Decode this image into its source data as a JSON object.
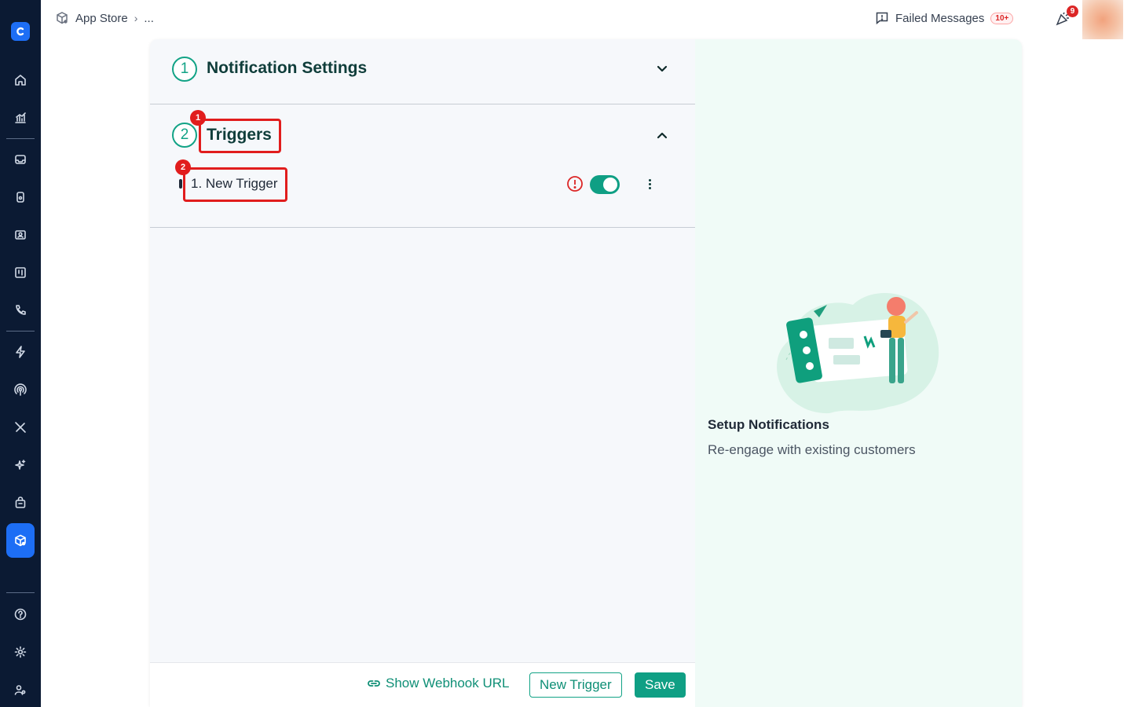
{
  "breadcrumb": {
    "root": "App Store",
    "more": "..."
  },
  "header": {
    "failed_messages_label": "Failed Messages",
    "failed_messages_count": "10+",
    "notification_count": "9"
  },
  "sections": [
    {
      "number": "1",
      "title": "Notification Settings",
      "expanded": false
    },
    {
      "number": "2",
      "title": "Triggers",
      "expanded": true
    }
  ],
  "triggers": [
    {
      "label": "1. New Trigger",
      "enabled": true,
      "has_warning": true
    }
  ],
  "annotations": [
    "1",
    "2"
  ],
  "footer": {
    "webhook_label": "Show Webhook URL",
    "new_trigger_label": "New Trigger",
    "save_label": "Save"
  },
  "side_panel": {
    "title": "Setup Notifications",
    "subtitle": "Re-engage with existing customers"
  },
  "colors": {
    "accent": "#12a386",
    "sidebar_bg": "#0b1a33",
    "active_nav": "#1d6ef5",
    "highlight": "#e11d1d"
  },
  "sidebar_icons": [
    "home-icon",
    "analytics-icon",
    "inbox-icon",
    "device-icon",
    "contacts-icon",
    "board-icon",
    "phone-icon",
    "bolt-icon",
    "broadcast-icon",
    "tools-icon",
    "sparkle-icon",
    "bag-icon",
    "app-store-icon",
    "help-icon",
    "settings-icon",
    "team-icon"
  ]
}
